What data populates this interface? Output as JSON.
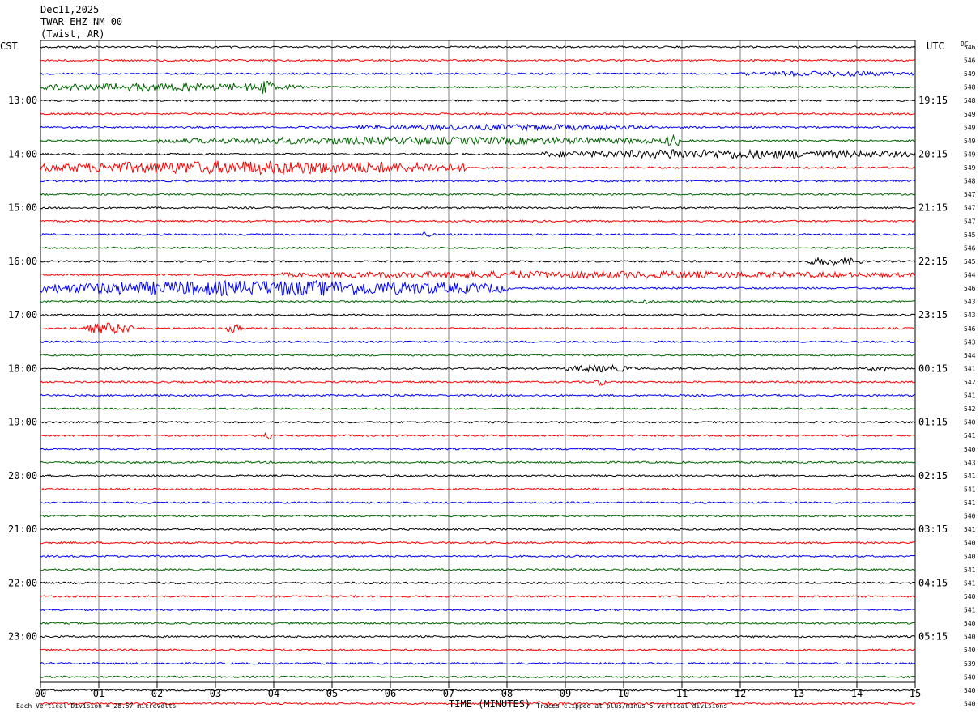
{
  "header": {
    "date": "Dec11,2025",
    "station": "TWAR EHZ NM 00",
    "location": "(Twist, AR)"
  },
  "left_tz": "CST",
  "right_tz": "UTC",
  "dc_header": "DC",
  "footer": {
    "left_note": "Each Vertical Division =   28.57 microvolts",
    "x_axis_label": "TIME (MINUTES)",
    "right_note": "Traces clipped at plus/minus 5 vertical divisions"
  },
  "chart_data": {
    "type": "line",
    "title": "",
    "xlabel": "TIME (MINUTES)",
    "xlim": [
      0,
      15
    ],
    "x_ticks": [
      "00",
      "01",
      "02",
      "03",
      "04",
      "05",
      "06",
      "07",
      "08",
      "09",
      "10",
      "11",
      "12",
      "13",
      "14",
      "15"
    ],
    "trace_colors": [
      "#000000",
      "#ff0000",
      "#0000ff",
      "#006400"
    ],
    "left_hour_labels": [
      "13:00",
      "14:00",
      "15:00",
      "16:00",
      "17:00",
      "18:00",
      "19:00",
      "20:00",
      "21:00",
      "22:00",
      "23:00"
    ],
    "right_hour_labels": [
      "19:15",
      "20:15",
      "21:15",
      "22:15",
      "23:15",
      "00:15",
      "01:15",
      "02:15",
      "03:15",
      "04:15",
      "05:15"
    ],
    "hour_label_first_trace": 4,
    "dc_offsets": [
      546,
      546,
      549,
      548,
      548,
      549,
      549,
      549,
      549,
      549,
      548,
      547,
      547,
      547,
      545,
      546,
      545,
      544,
      546,
      543,
      543,
      546,
      543,
      544,
      541,
      542,
      541,
      542,
      540,
      541,
      540,
      543,
      541,
      541,
      541,
      540,
      541,
      540,
      540,
      541,
      541,
      540,
      541,
      540,
      540,
      540,
      539,
      540,
      540,
      540
    ],
    "background_amplitude": 0.35,
    "events": [
      {
        "trace": 3,
        "start": 0.0,
        "end": 4.5,
        "amp": 1.6
      },
      {
        "trace": 3,
        "start": 3.75,
        "end": 4.0,
        "amp": 3.0
      },
      {
        "trace": 2,
        "start": 12.0,
        "end": 15.0,
        "amp": 1.0
      },
      {
        "trace": 6,
        "start": 5.4,
        "end": 10.5,
        "amp": 1.2
      },
      {
        "trace": 7,
        "start": 2.0,
        "end": 11.0,
        "amp": 1.5
      },
      {
        "trace": 7,
        "start": 10.7,
        "end": 11.0,
        "amp": 2.4
      },
      {
        "trace": 8,
        "start": 8.6,
        "end": 15.0,
        "amp": 1.8
      },
      {
        "trace": 8,
        "start": 10.7,
        "end": 11.0,
        "amp": 2.4
      },
      {
        "trace": 9,
        "start": 0.0,
        "end": 7.3,
        "amp": 2.6
      },
      {
        "trace": 14,
        "start": 6.5,
        "end": 6.7,
        "amp": 1.1
      },
      {
        "trace": 16,
        "start": 13.1,
        "end": 14.1,
        "amp": 1.6
      },
      {
        "trace": 17,
        "start": 4.0,
        "end": 15.0,
        "amp": 1.4
      },
      {
        "trace": 18,
        "start": 0.0,
        "end": 8.0,
        "amp": 3.0
      },
      {
        "trace": 19,
        "start": 10.2,
        "end": 10.5,
        "amp": 1.0
      },
      {
        "trace": 21,
        "start": 0.75,
        "end": 1.6,
        "amp": 2.2
      },
      {
        "trace": 21,
        "start": 3.2,
        "end": 3.45,
        "amp": 1.8
      },
      {
        "trace": 24,
        "start": 9.0,
        "end": 10.2,
        "amp": 1.4
      },
      {
        "trace": 24,
        "start": 14.2,
        "end": 14.5,
        "amp": 1.3
      },
      {
        "trace": 25,
        "start": 9.5,
        "end": 9.7,
        "amp": 1.4
      },
      {
        "trace": 29,
        "start": 3.8,
        "end": 3.95,
        "amp": 2.0
      },
      {
        "trace": 49,
        "start": 8.3,
        "end": 9.0,
        "amp": 0.9
      }
    ]
  }
}
